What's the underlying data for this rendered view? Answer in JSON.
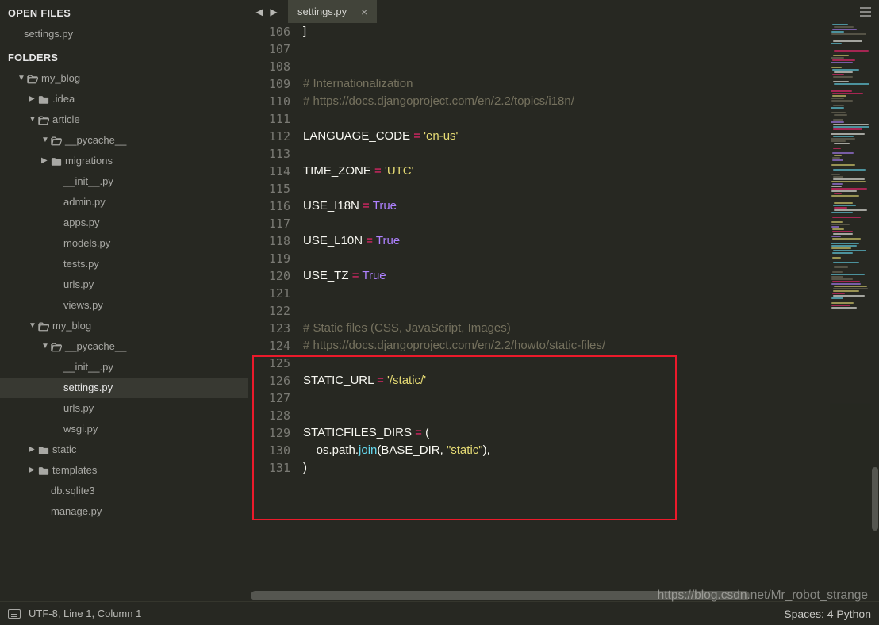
{
  "sidebar": {
    "open_files_header": "OPEN FILES",
    "open_files": [
      "settings.py"
    ],
    "folders_header": "FOLDERS",
    "tree": [
      {
        "label": "my_blog",
        "type": "folder-open",
        "indent": 1,
        "expanded": true
      },
      {
        "label": ".idea",
        "type": "folder",
        "indent": 2,
        "expanded": false
      },
      {
        "label": "article",
        "type": "folder-open",
        "indent": 2,
        "expanded": true
      },
      {
        "label": "__pycache__",
        "type": "folder-open",
        "indent": 3,
        "expanded": true
      },
      {
        "label": "migrations",
        "type": "folder",
        "indent": 3,
        "expanded": false
      },
      {
        "label": "__init__.py",
        "type": "file",
        "indent": 4
      },
      {
        "label": "admin.py",
        "type": "file",
        "indent": 4
      },
      {
        "label": "apps.py",
        "type": "file",
        "indent": 4
      },
      {
        "label": "models.py",
        "type": "file",
        "indent": 4
      },
      {
        "label": "tests.py",
        "type": "file",
        "indent": 4
      },
      {
        "label": "urls.py",
        "type": "file",
        "indent": 4
      },
      {
        "label": "views.py",
        "type": "file",
        "indent": 4
      },
      {
        "label": "my_blog",
        "type": "folder-open",
        "indent": 2,
        "expanded": true
      },
      {
        "label": "__pycache__",
        "type": "folder-open",
        "indent": 3,
        "expanded": true
      },
      {
        "label": "__init__.py",
        "type": "file",
        "indent": 4
      },
      {
        "label": "settings.py",
        "type": "file",
        "indent": 4,
        "active": true
      },
      {
        "label": "urls.py",
        "type": "file",
        "indent": 4
      },
      {
        "label": "wsgi.py",
        "type": "file",
        "indent": 4
      },
      {
        "label": "static",
        "type": "folder",
        "indent": 2,
        "expanded": false
      },
      {
        "label": "templates",
        "type": "folder",
        "indent": 2,
        "expanded": false
      },
      {
        "label": "db.sqlite3",
        "type": "file",
        "indent": 3
      },
      {
        "label": "manage.py",
        "type": "file",
        "indent": 3
      }
    ]
  },
  "tab": {
    "name": "settings.py"
  },
  "code": {
    "first_line": 106,
    "lines": [
      {
        "n": 106,
        "segments": [
          {
            "t": "]",
            "c": ""
          }
        ]
      },
      {
        "n": 107,
        "segments": []
      },
      {
        "n": 108,
        "segments": []
      },
      {
        "n": 109,
        "segments": [
          {
            "t": "# Internationalization",
            "c": "c-comment"
          }
        ]
      },
      {
        "n": 110,
        "segments": [
          {
            "t": "# https://docs.djangoproject.com/en/2.2/topics/i18n/",
            "c": "c-comment"
          }
        ]
      },
      {
        "n": 111,
        "segments": []
      },
      {
        "n": 112,
        "segments": [
          {
            "t": "LANGUAGE_CODE ",
            "c": ""
          },
          {
            "t": "=",
            "c": "c-keyword"
          },
          {
            "t": " ",
            "c": ""
          },
          {
            "t": "'en-us'",
            "c": "c-string"
          }
        ]
      },
      {
        "n": 113,
        "segments": []
      },
      {
        "n": 114,
        "segments": [
          {
            "t": "TIME_ZONE ",
            "c": ""
          },
          {
            "t": "=",
            "c": "c-keyword"
          },
          {
            "t": " ",
            "c": ""
          },
          {
            "t": "'UTC'",
            "c": "c-string"
          }
        ]
      },
      {
        "n": 115,
        "segments": []
      },
      {
        "n": 116,
        "segments": [
          {
            "t": "USE_I18N ",
            "c": ""
          },
          {
            "t": "=",
            "c": "c-keyword"
          },
          {
            "t": " ",
            "c": ""
          },
          {
            "t": "True",
            "c": "c-const"
          }
        ]
      },
      {
        "n": 117,
        "segments": []
      },
      {
        "n": 118,
        "segments": [
          {
            "t": "USE_L10N ",
            "c": ""
          },
          {
            "t": "=",
            "c": "c-keyword"
          },
          {
            "t": " ",
            "c": ""
          },
          {
            "t": "True",
            "c": "c-const"
          }
        ]
      },
      {
        "n": 119,
        "segments": []
      },
      {
        "n": 120,
        "segments": [
          {
            "t": "USE_TZ ",
            "c": ""
          },
          {
            "t": "=",
            "c": "c-keyword"
          },
          {
            "t": " ",
            "c": ""
          },
          {
            "t": "True",
            "c": "c-const"
          }
        ]
      },
      {
        "n": 121,
        "segments": []
      },
      {
        "n": 122,
        "segments": []
      },
      {
        "n": 123,
        "segments": [
          {
            "t": "# Static files (CSS, JavaScript, Images)",
            "c": "c-comment"
          }
        ]
      },
      {
        "n": 124,
        "segments": [
          {
            "t": "# https://docs.djangoproject.com/en/2.2/howto/static-files/",
            "c": "c-comment"
          }
        ]
      },
      {
        "n": 125,
        "segments": []
      },
      {
        "n": 126,
        "segments": [
          {
            "t": "STATIC_URL ",
            "c": ""
          },
          {
            "t": "=",
            "c": "c-keyword"
          },
          {
            "t": " ",
            "c": ""
          },
          {
            "t": "'/static/'",
            "c": "c-string"
          }
        ]
      },
      {
        "n": 127,
        "segments": []
      },
      {
        "n": 128,
        "segments": []
      },
      {
        "n": 129,
        "segments": [
          {
            "t": "STATICFILES_DIRS ",
            "c": ""
          },
          {
            "t": "=",
            "c": "c-keyword"
          },
          {
            "t": " (",
            "c": ""
          }
        ]
      },
      {
        "n": 130,
        "segments": [
          {
            "t": "    os.path.",
            "c": ""
          },
          {
            "t": "join",
            "c": "c-func"
          },
          {
            "t": "(BASE_DIR, ",
            "c": ""
          },
          {
            "t": "\"static\"",
            "c": "c-string"
          },
          {
            "t": "),",
            "c": ""
          }
        ]
      },
      {
        "n": 131,
        "segments": [
          {
            "t": ")",
            "c": ""
          }
        ]
      }
    ]
  },
  "status": {
    "text": "UTF-8, Line 1, Column 1",
    "right": "Spaces: 4     Python"
  },
  "watermark": "https://blog.csdn.net/Mr_robot_strange"
}
